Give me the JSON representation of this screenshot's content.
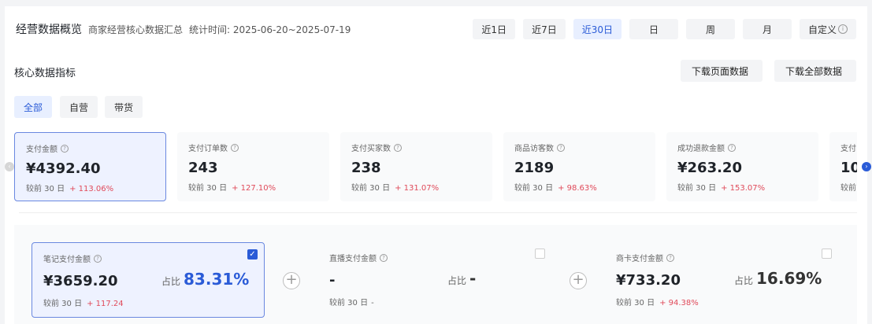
{
  "header": {
    "title": "经营数据概览",
    "subtitle": "商家经营核心数据汇总",
    "stat_time": "统计时间: 2025-06-20~2025-07-19",
    "ranges": [
      {
        "label": "近1日",
        "active": false
      },
      {
        "label": "近7日",
        "active": false
      },
      {
        "label": "近30日",
        "active": true
      },
      {
        "label": "日",
        "active": false
      },
      {
        "label": "周",
        "active": false
      },
      {
        "label": "月",
        "active": false
      },
      {
        "label": "自定义",
        "active": false
      }
    ]
  },
  "core": {
    "title": "核心数据指标",
    "download_page": "下载页面数据",
    "download_all": "下载全部数据",
    "segments": [
      "全部",
      "自营",
      "带货"
    ]
  },
  "metrics": [
    {
      "label": "支付金额",
      "value": "¥4392.40",
      "compare": "较前 30 日",
      "delta": "+ 113.06%"
    },
    {
      "label": "支付订单数",
      "value": "243",
      "compare": "较前 30 日",
      "delta": "+ 127.10%"
    },
    {
      "label": "支付买家数",
      "value": "238",
      "compare": "较前 30 日",
      "delta": "+ 131.07%"
    },
    {
      "label": "商品访客数",
      "value": "2189",
      "compare": "较前 30 日",
      "delta": "+ 98.63%"
    },
    {
      "label": "成功退款金额",
      "value": "¥263.20",
      "compare": "较前 30 日",
      "delta": "+ 153.07%"
    },
    {
      "label": "支付",
      "value": "10",
      "compare": "较前"
    }
  ],
  "breakdown": [
    {
      "label": "笔记支付金额",
      "value": "¥3659.20",
      "share_label": "占比",
      "share": "83.31%",
      "compare": "较前 30 日",
      "delta": "+ 117.24",
      "checked": "✓"
    },
    {
      "label": "直播支付金额",
      "value": "-",
      "share_label": "占比",
      "share": "-",
      "compare": "较前 30 日",
      "delta": "-"
    },
    {
      "label": "商卡支付金额",
      "value": "¥733.20",
      "share_label": "占比",
      "share": "16.69%",
      "compare": "较前 30 日",
      "delta": "+ 94.38%"
    }
  ],
  "icons": {
    "info": "i",
    "help": "?",
    "plus": "+",
    "arrow_left": "‹",
    "arrow_right": "›"
  },
  "colors": {
    "accent": "#2a5bd7",
    "positive_delta": "#e04a5a",
    "selected_bg": "#eef2ff"
  }
}
